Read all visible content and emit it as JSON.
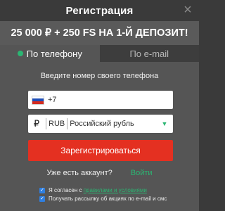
{
  "header": {
    "title": "Регистрация",
    "close_glyph": "×"
  },
  "promo": {
    "text": "25 000 ₽ + 250 FS НА 1-Й ДЕПОЗИТ!"
  },
  "tabs": [
    {
      "label": "По телефону",
      "active": true
    },
    {
      "label": "По e-mail",
      "active": false
    }
  ],
  "form": {
    "instruction": "Введите номер своего телефона",
    "phone": {
      "prefix": "+7",
      "value": "",
      "flag": "ru-flag-icon"
    },
    "currency": {
      "symbol": "₽",
      "code": "RUB",
      "name": "Российский рубль",
      "caret": "▼"
    },
    "register_label": "Зарегистрироваться"
  },
  "login": {
    "question": "Уже есть аккаунт?",
    "link": "Войти"
  },
  "consents": [
    {
      "text_before": "Я согласен с ",
      "link": "правилами и условиями",
      "checked": true
    },
    {
      "text": "Получать рассылку об акциях по e-mail и смс",
      "checked": true
    }
  ],
  "colors": {
    "accent_green": "#2bb673",
    "button_red": "#e43021",
    "checkbox_blue": "#2f7fe0"
  }
}
